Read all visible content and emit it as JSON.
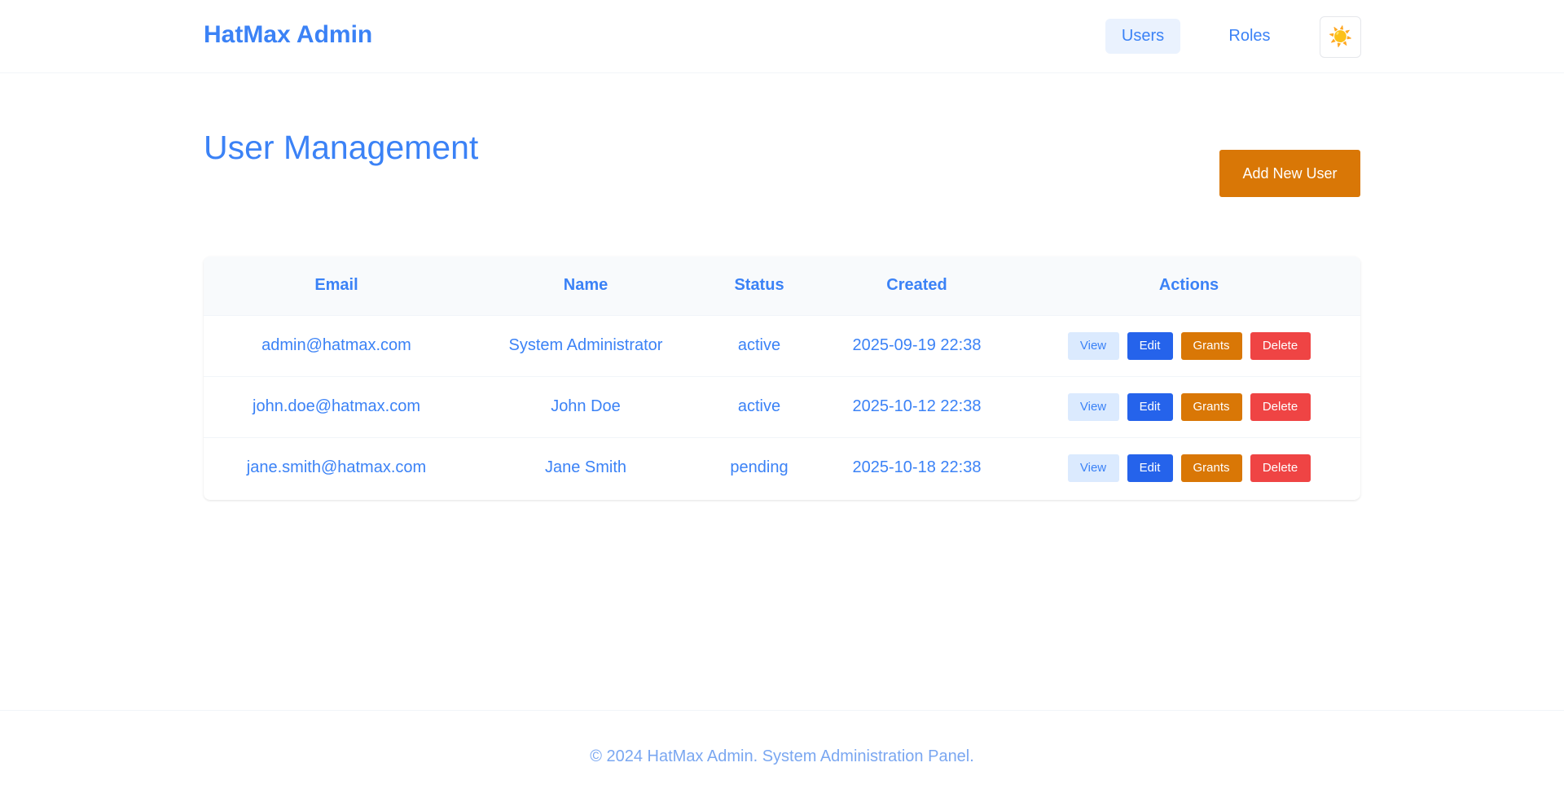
{
  "header": {
    "brand": "HatMax Admin",
    "nav": [
      {
        "label": "Users",
        "active": true
      },
      {
        "label": "Roles",
        "active": false
      }
    ],
    "theme_icon": "sun-icon",
    "theme_glyph": "☀️"
  },
  "main": {
    "title": "User Management",
    "add_button": "Add New User",
    "table": {
      "columns": [
        "Email",
        "Name",
        "Status",
        "Created",
        "Actions"
      ],
      "rows": [
        {
          "email": "admin@hatmax.com",
          "name": "System Administrator",
          "status": "active",
          "created": "2025-09-19 22:38"
        },
        {
          "email": "john.doe@hatmax.com",
          "name": "John Doe",
          "status": "active",
          "created": "2025-10-12 22:38"
        },
        {
          "email": "jane.smith@hatmax.com",
          "name": "Jane Smith",
          "status": "pending",
          "created": "2025-10-18 22:38"
        }
      ],
      "actions": {
        "view": "View",
        "edit": "Edit",
        "grants": "Grants",
        "delete": "Delete"
      }
    }
  },
  "footer": {
    "text": "© 2024 HatMax Admin. System Administration Panel."
  },
  "colors": {
    "primary": "#3b82f6",
    "nav_active_bg": "#eaf2fe",
    "add_button": "#d97706",
    "view": "#dbeafe",
    "edit": "#2563eb",
    "grants": "#d97706",
    "delete": "#ef4444"
  }
}
